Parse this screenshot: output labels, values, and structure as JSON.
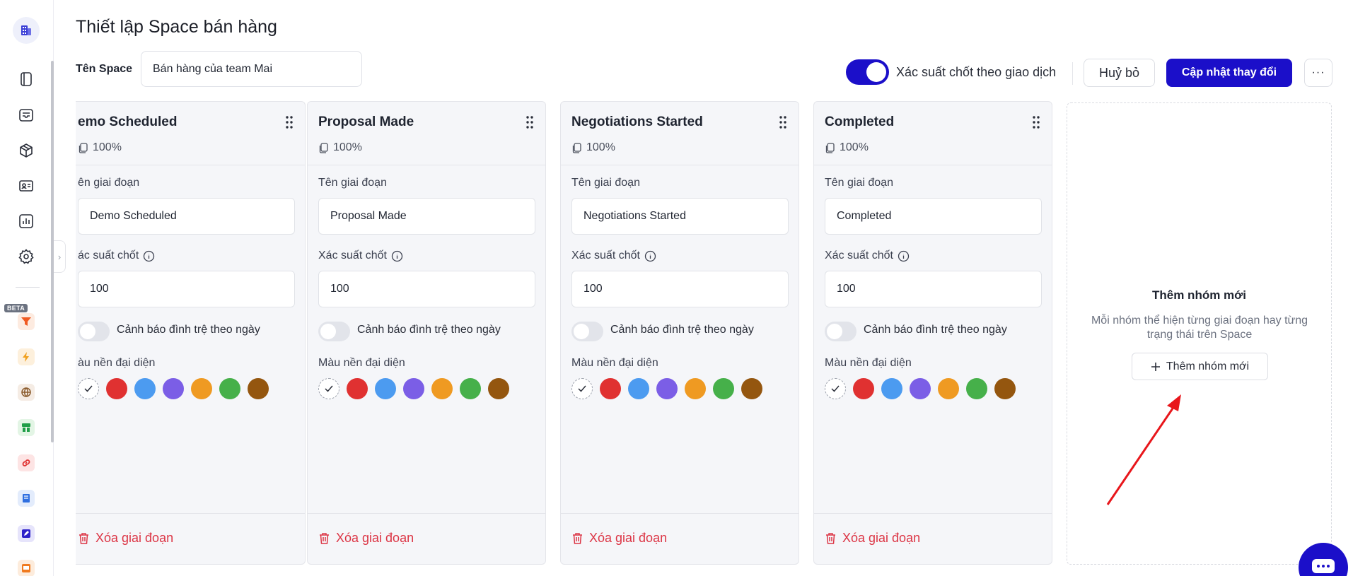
{
  "header": {
    "title": "Thiết lập Space bán hàng",
    "space_label": "Tên Space",
    "space_value": "Bán hàng của team Mai",
    "toggle_label": "Xác suất chốt theo giao dịch",
    "cancel_label": "Huỷ bỏ",
    "update_label": "Cập nhật thay đổi"
  },
  "sidebar": {
    "beta_badge": "BETA",
    "nav_icons": [
      "notebook-icon",
      "inbox-icon",
      "box-icon",
      "contact-card-icon",
      "bar-chart-icon",
      "gear-icon"
    ],
    "app_icons": [
      "funnel-app-icon",
      "bolt-app-icon",
      "globe-app-icon",
      "store-app-icon",
      "link-app-icon",
      "book-app-icon",
      "edit-app-icon",
      "slides-app-icon"
    ]
  },
  "columns": [
    {
      "title": "emo Scheduled",
      "percent": "100%",
      "stage_label": "ên giai đoạn",
      "stage_value": "Demo Scheduled",
      "prob_label": "ác suất chốt",
      "prob_value": "100",
      "stale_label": "Cảnh báo đình trệ theo ngày",
      "color_label": "àu nền đại diện",
      "delete_label": "Xóa giai đoạn"
    },
    {
      "title": "Proposal Made",
      "percent": "100%",
      "stage_label": "Tên giai đoạn",
      "stage_value": "Proposal Made",
      "prob_label": "Xác suất chốt",
      "prob_value": "100",
      "stale_label": "Cảnh báo đình trệ theo ngày",
      "color_label": "Màu nền đại diện",
      "delete_label": "Xóa giai đoạn"
    },
    {
      "title": "Negotiations Started",
      "percent": "100%",
      "stage_label": "Tên giai đoạn",
      "stage_value": "Negotiations Started",
      "prob_label": "Xác suất chốt",
      "prob_value": "100",
      "stale_label": "Cảnh báo đình trệ theo ngày",
      "color_label": "Màu nền đại diện",
      "delete_label": "Xóa giai đoạn"
    },
    {
      "title": "Completed",
      "percent": "100%",
      "stage_label": "Tên giai đoạn",
      "stage_value": "Completed",
      "prob_label": "Xác suất chốt",
      "prob_value": "100",
      "stale_label": "Cảnh báo đình trệ theo ngày",
      "color_label": "Màu nền đại diện",
      "delete_label": "Xóa giai đoạn"
    }
  ],
  "swatch_colors": [
    "#e03131",
    "#4c9bf0",
    "#7b5ee6",
    "#ef9a22",
    "#46b04a",
    "#94560f"
  ],
  "add_group": {
    "title": "Thêm nhóm mới",
    "description": "Mỗi nhóm thể hiện từng giai đoạn hay từng trạng thái trên Space",
    "button_label": "Thêm nhóm mới"
  },
  "colors": {
    "accent": "#1b0fc9",
    "danger": "#dc3545",
    "annotation_arrow": "#e8161b"
  }
}
